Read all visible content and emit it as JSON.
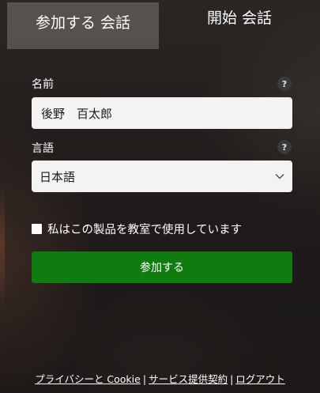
{
  "tabs": {
    "join_label": "参加する 会話",
    "start_label": "開始 会話"
  },
  "form": {
    "name_label": "名前",
    "name_value": "後野　百太郎",
    "language_label": "言語",
    "language_value": "日本語",
    "help_glyph": "?",
    "classroom_checkbox_label": "私はこの製品を教室で使用しています",
    "classroom_checked": false,
    "join_button_label": "参加する"
  },
  "footer": {
    "privacy_label": "プライバシーと Cookie",
    "separator": "|",
    "terms_label": "サービス提供契約",
    "logout_label": "ログアウト"
  },
  "colors": {
    "accent_green": "#107c10",
    "field_bg": "#f4f3f2"
  },
  "icons": [
    "help-icon",
    "chevron-down-icon",
    "checkbox-icon"
  ]
}
